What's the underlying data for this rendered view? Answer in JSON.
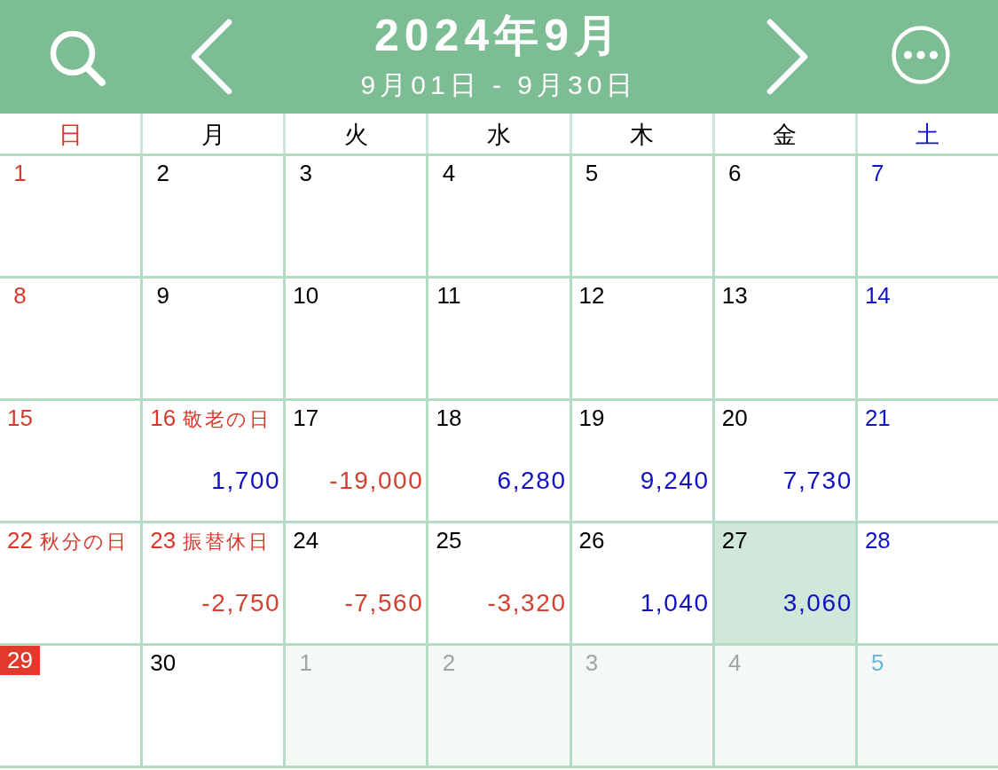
{
  "header": {
    "title": "2024年9月",
    "range": "9月01日 - 9月30日"
  },
  "weekdays": [
    {
      "label": "日",
      "kind": "sunday"
    },
    {
      "label": "月",
      "kind": "weekday"
    },
    {
      "label": "火",
      "kind": "weekday"
    },
    {
      "label": "水",
      "kind": "weekday"
    },
    {
      "label": "木",
      "kind": "weekday"
    },
    {
      "label": "金",
      "kind": "weekday"
    },
    {
      "label": "土",
      "kind": "saturday"
    }
  ],
  "weeks": [
    {
      "days": [
        {
          "day": "1",
          "kind": "sunday",
          "outside": false,
          "selected": false,
          "today": false
        },
        {
          "day": "2",
          "kind": "weekday",
          "outside": false,
          "selected": false,
          "today": false
        },
        {
          "day": "3",
          "kind": "weekday",
          "outside": false,
          "selected": false,
          "today": false
        },
        {
          "day": "4",
          "kind": "weekday",
          "outside": false,
          "selected": false,
          "today": false
        },
        {
          "day": "5",
          "kind": "weekday",
          "outside": false,
          "selected": false,
          "today": false
        },
        {
          "day": "6",
          "kind": "weekday",
          "outside": false,
          "selected": false,
          "today": false
        },
        {
          "day": "7",
          "kind": "saturday",
          "outside": false,
          "selected": false,
          "today": false
        }
      ]
    },
    {
      "days": [
        {
          "day": "8",
          "kind": "sunday",
          "outside": false,
          "selected": false,
          "today": false
        },
        {
          "day": "9",
          "kind": "weekday",
          "outside": false,
          "selected": false,
          "today": false
        },
        {
          "day": "10",
          "kind": "weekday",
          "outside": false,
          "selected": false,
          "today": false
        },
        {
          "day": "11",
          "kind": "weekday",
          "outside": false,
          "selected": false,
          "today": false
        },
        {
          "day": "12",
          "kind": "weekday",
          "outside": false,
          "selected": false,
          "today": false
        },
        {
          "day": "13",
          "kind": "weekday",
          "outside": false,
          "selected": false,
          "today": false
        },
        {
          "day": "14",
          "kind": "saturday",
          "outside": false,
          "selected": false,
          "today": false
        }
      ]
    },
    {
      "days": [
        {
          "day": "15",
          "kind": "sunday",
          "outside": false,
          "selected": false,
          "today": false
        },
        {
          "day": "16",
          "kind": "holiday",
          "holiday": "敬老の日",
          "amount": {
            "value": "1,700",
            "kind": "income"
          },
          "outside": false,
          "selected": false,
          "today": false
        },
        {
          "day": "17",
          "kind": "weekday",
          "amount": {
            "value": "-19,000",
            "kind": "expense"
          },
          "outside": false,
          "selected": false,
          "today": false
        },
        {
          "day": "18",
          "kind": "weekday",
          "amount": {
            "value": "6,280",
            "kind": "income"
          },
          "outside": false,
          "selected": false,
          "today": false
        },
        {
          "day": "19",
          "kind": "weekday",
          "amount": {
            "value": "9,240",
            "kind": "income"
          },
          "outside": false,
          "selected": false,
          "today": false
        },
        {
          "day": "20",
          "kind": "weekday",
          "amount": {
            "value": "7,730",
            "kind": "income"
          },
          "outside": false,
          "selected": false,
          "today": false
        },
        {
          "day": "21",
          "kind": "saturday",
          "outside": false,
          "selected": false,
          "today": false
        }
      ]
    },
    {
      "days": [
        {
          "day": "22",
          "kind": "sunday",
          "holiday": "秋分の日",
          "outside": false,
          "selected": false,
          "today": false
        },
        {
          "day": "23",
          "kind": "holiday",
          "holiday": "振替休日",
          "amount": {
            "value": "-2,750",
            "kind": "expense"
          },
          "outside": false,
          "selected": false,
          "today": false
        },
        {
          "day": "24",
          "kind": "weekday",
          "amount": {
            "value": "-7,560",
            "kind": "expense"
          },
          "outside": false,
          "selected": false,
          "today": false
        },
        {
          "day": "25",
          "kind": "weekday",
          "amount": {
            "value": "-3,320",
            "kind": "expense"
          },
          "outside": false,
          "selected": false,
          "today": false
        },
        {
          "day": "26",
          "kind": "weekday",
          "amount": {
            "value": "1,040",
            "kind": "income"
          },
          "outside": false,
          "selected": false,
          "today": false
        },
        {
          "day": "27",
          "kind": "weekday",
          "amount": {
            "value": "3,060",
            "kind": "income"
          },
          "outside": false,
          "selected": true,
          "today": false
        },
        {
          "day": "28",
          "kind": "saturday",
          "outside": false,
          "selected": false,
          "today": false
        }
      ]
    },
    {
      "days": [
        {
          "day": "29",
          "kind": "sunday",
          "outside": false,
          "selected": false,
          "today": true
        },
        {
          "day": "30",
          "kind": "weekday",
          "outside": false,
          "selected": false,
          "today": false
        },
        {
          "day": "1",
          "kind": "weekday",
          "outside": true,
          "selected": false,
          "today": false
        },
        {
          "day": "2",
          "kind": "weekday",
          "outside": true,
          "selected": false,
          "today": false
        },
        {
          "day": "3",
          "kind": "weekday",
          "outside": true,
          "selected": false,
          "today": false
        },
        {
          "day": "4",
          "kind": "weekday",
          "outside": true,
          "selected": false,
          "today": false
        },
        {
          "day": "5",
          "kind": "saturday",
          "outside": true,
          "selected": false,
          "today": false
        }
      ]
    }
  ]
}
